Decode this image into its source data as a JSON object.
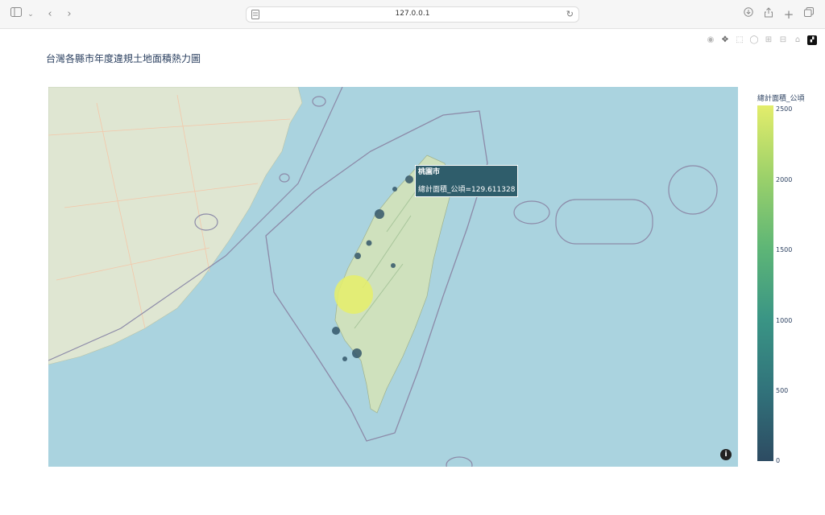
{
  "browser": {
    "url": "127.0.0.1"
  },
  "chart": {
    "title": "台灣各縣市年度違規土地面積熱力圖",
    "colorbar_title": "總計面積_公頃",
    "colorbar_ticks": [
      "2500",
      "2000",
      "1500",
      "1000",
      "500",
      "0"
    ]
  },
  "hover": {
    "name": "桃園市",
    "text": "總計面積_公頃=129.611328"
  },
  "chart_data": {
    "type": "scatter",
    "title": "台灣各縣市年度違規土地面積熱力圖",
    "colorbar": {
      "title": "總計面積_公頃",
      "range": [
        0,
        2500
      ]
    },
    "points": [
      {
        "name": "桃園市",
        "value": 129.611328
      },
      {
        "value": 2500
      },
      {
        "value": 300
      },
      {
        "value": 260
      },
      {
        "value": 220
      },
      {
        "value": 120
      },
      {
        "value": 110
      },
      {
        "value": 100
      },
      {
        "value": 90
      },
      {
        "value": 80
      }
    ]
  }
}
